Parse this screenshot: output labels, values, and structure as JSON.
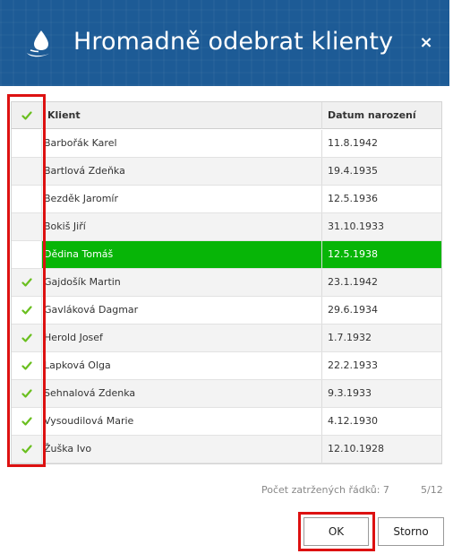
{
  "dialog": {
    "title": "Hromadně odebrat klienty",
    "close_symbol": "×",
    "icon": "drop-logo-icon",
    "colors": {
      "header_bg": "#1d5b96",
      "selected_row": "#07b507",
      "checkmark": "#6abf1f",
      "highlight": "#dd1111"
    }
  },
  "grid": {
    "columns": {
      "check": "✔",
      "client": "Klient",
      "birth_date": "Datum narození"
    },
    "rows": [
      {
        "name": "Barbořák Karel",
        "date": "11.8.1942",
        "checked": false,
        "selected": false
      },
      {
        "name": "Bartlová Zdeňka",
        "date": "19.4.1935",
        "checked": false,
        "selected": false
      },
      {
        "name": "Bezděk Jaromír",
        "date": "12.5.1936",
        "checked": false,
        "selected": false
      },
      {
        "name": "Bokiš Jiří",
        "date": "31.10.1933",
        "checked": false,
        "selected": false
      },
      {
        "name": "Dědina Tomáš",
        "date": "12.5.1938",
        "checked": false,
        "selected": true
      },
      {
        "name": "Gajdošík Martin",
        "date": "23.1.1942",
        "checked": true,
        "selected": false
      },
      {
        "name": "Gavláková Dagmar",
        "date": "29.6.1934",
        "checked": true,
        "selected": false
      },
      {
        "name": "Herold Josef",
        "date": "1.7.1932",
        "checked": true,
        "selected": false
      },
      {
        "name": "Lapková Olga",
        "date": "22.2.1933",
        "checked": true,
        "selected": false
      },
      {
        "name": "Sehnalová Zdenka",
        "date": "9.3.1933",
        "checked": true,
        "selected": false
      },
      {
        "name": "Vysoudilová Marie",
        "date": "4.12.1930",
        "checked": true,
        "selected": false
      },
      {
        "name": "Žuška Ivo",
        "date": "12.10.1928",
        "checked": true,
        "selected": false
      }
    ]
  },
  "footer": {
    "checked_count": "Počet zatržených řádků: 7",
    "pager": "5/12",
    "ok_label": "OK",
    "cancel_label": "Storno"
  }
}
